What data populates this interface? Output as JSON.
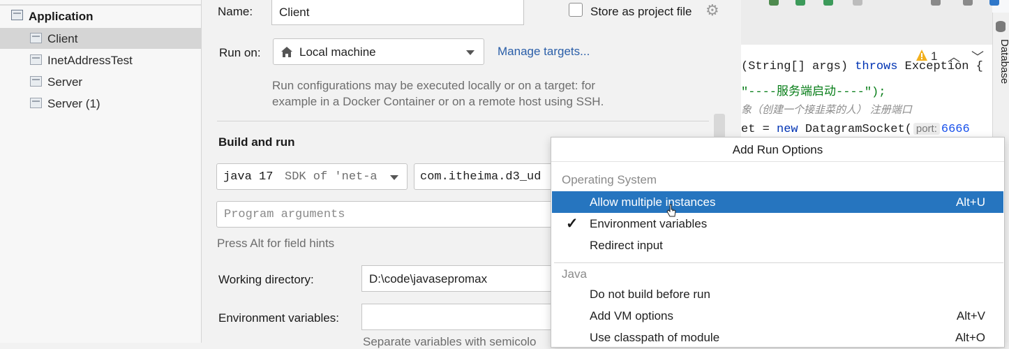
{
  "tree": {
    "group": "Application",
    "items": [
      {
        "label": "Client"
      },
      {
        "label": "InetAddressTest"
      },
      {
        "label": "Server"
      },
      {
        "label": "Server (1)"
      }
    ]
  },
  "form": {
    "name_label": "Name:",
    "name_value": "Client",
    "store_label": "Store as project file",
    "run_on_label": "Run on:",
    "run_on_value": "Local machine",
    "manage_targets": "Manage targets...",
    "run_on_help_1": "Run configurations may be executed locally or on a target: for",
    "run_on_help_2": "example in a Docker Container or on a remote host using SSH.",
    "build_heading": "Build and run",
    "sdk_java": "java 17",
    "sdk_rest": "SDK of 'net-a",
    "main_class": "com.itheima.d3_ud",
    "program_args_placeholder": "Program arguments",
    "field_hint": "Press Alt for field hints",
    "workdir_label": "Working directory:",
    "workdir_value": "D:\\code\\javasepromax",
    "env_label": "Environment variables:",
    "env_value": "",
    "env_help": "Separate variables with semicolo"
  },
  "editor": {
    "line1_a": "(String[] args) ",
    "line1_kw": "throws",
    "line1_b": " Exception {",
    "line2": "\"----服务端启动----\");",
    "line3": "象（创建一个接韭菜的人） 注册端口",
    "line4_a": "et = ",
    "line4_kw": "new",
    "line4_b": " DatagramSocket(",
    "line4_hint": "port:",
    "line4_num": "6666",
    "warning_count": "1",
    "side_tab": "Database"
  },
  "popup": {
    "title": "Add Run Options",
    "groups": [
      {
        "name": "Operating System",
        "items": [
          {
            "label": "Allow multiple instances",
            "shortcut": "Alt+U",
            "checked": false,
            "selected": true
          },
          {
            "label": "Environment variables",
            "shortcut": "",
            "checked": true,
            "selected": false
          },
          {
            "label": "Redirect input",
            "shortcut": "",
            "checked": false,
            "selected": false
          }
        ]
      },
      {
        "name": "Java",
        "items": [
          {
            "label": "Do not build before run",
            "shortcut": "",
            "checked": false,
            "selected": false
          },
          {
            "label": "Add VM options",
            "shortcut": "Alt+V",
            "checked": false,
            "selected": false
          },
          {
            "label": "Use classpath of module",
            "shortcut": "Alt+O",
            "checked": false,
            "selected": false
          }
        ]
      }
    ],
    "check_glyph": "✓"
  },
  "colors": {
    "selection": "#2675bf",
    "link": "#2a5ea8",
    "keyword": "#0033b3",
    "number": "#1750eb",
    "string": "#067d17"
  }
}
